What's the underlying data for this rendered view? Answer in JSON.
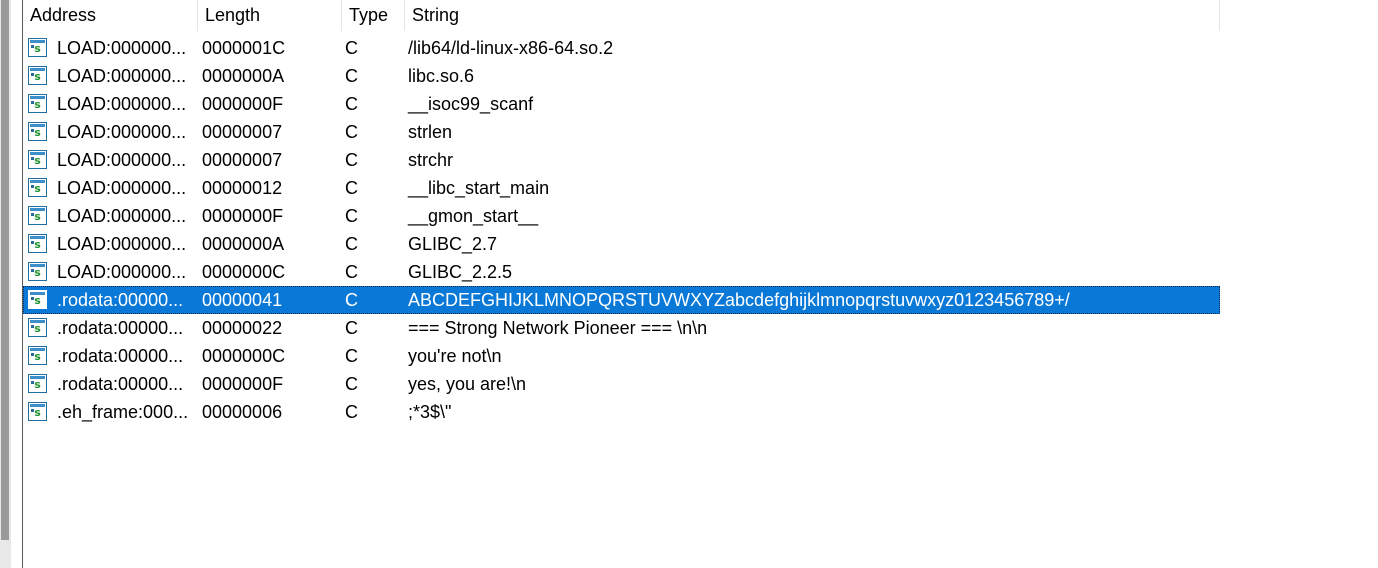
{
  "columns": {
    "address": "Address",
    "length": "Length",
    "type": "Type",
    "string": "String"
  },
  "colors": {
    "selection": "#0a78d7",
    "icon_border": "#1f6fa3",
    "icon_glyph": "#1f8f2f"
  },
  "icons": {
    "row_icon": "string-literal-icon"
  },
  "selected_index": 9,
  "rows": [
    {
      "address": "LOAD:000000...",
      "length": "0000001C",
      "type": "C",
      "string": "/lib64/ld-linux-x86-64.so.2"
    },
    {
      "address": "LOAD:000000...",
      "length": "0000000A",
      "type": "C",
      "string": "libc.so.6"
    },
    {
      "address": "LOAD:000000...",
      "length": "0000000F",
      "type": "C",
      "string": "__isoc99_scanf"
    },
    {
      "address": "LOAD:000000...",
      "length": "00000007",
      "type": "C",
      "string": "strlen"
    },
    {
      "address": "LOAD:000000...",
      "length": "00000007",
      "type": "C",
      "string": "strchr"
    },
    {
      "address": "LOAD:000000...",
      "length": "00000012",
      "type": "C",
      "string": "__libc_start_main"
    },
    {
      "address": "LOAD:000000...",
      "length": "0000000F",
      "type": "C",
      "string": "__gmon_start__"
    },
    {
      "address": "LOAD:000000...",
      "length": "0000000A",
      "type": "C",
      "string": "GLIBC_2.7"
    },
    {
      "address": "LOAD:000000...",
      "length": "0000000C",
      "type": "C",
      "string": "GLIBC_2.2.5"
    },
    {
      "address": ".rodata:00000...",
      "length": "00000041",
      "type": "C",
      "string": "ABCDEFGHIJKLMNOPQRSTUVWXYZabcdefghijklmnopqrstuvwxyz0123456789+/"
    },
    {
      "address": ".rodata:00000...",
      "length": "00000022",
      "type": "C",
      "string": "=== Strong Network Pioneer === \\n\\n"
    },
    {
      "address": ".rodata:00000...",
      "length": "0000000C",
      "type": "C",
      "string": "you're not\\n"
    },
    {
      "address": ".rodata:00000...",
      "length": "0000000F",
      "type": "C",
      "string": "yes, you are!\\n"
    },
    {
      "address": ".eh_frame:000...",
      "length": "00000006",
      "type": "C",
      "string": ";*3$\\\""
    }
  ]
}
